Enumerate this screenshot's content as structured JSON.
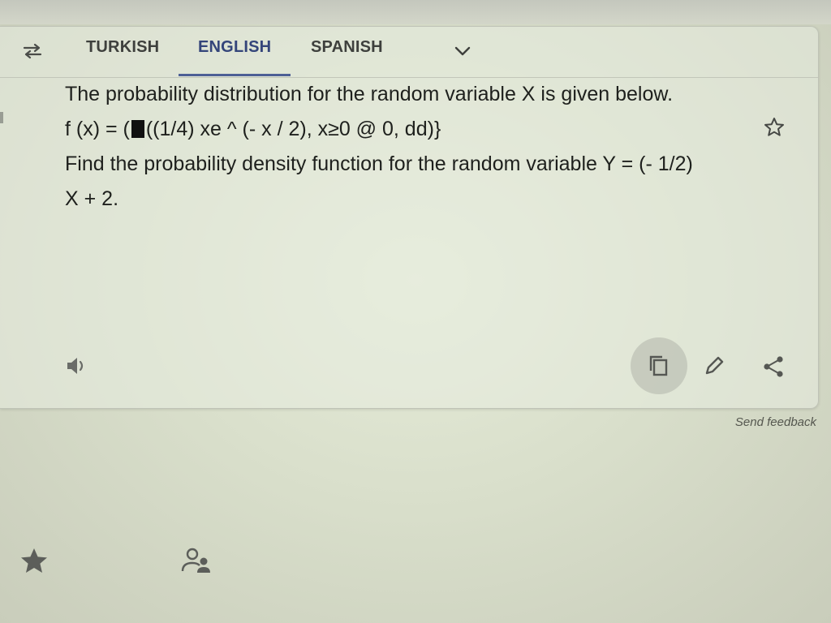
{
  "tabs": [
    {
      "label": "TURKISH",
      "active": false
    },
    {
      "label": "ENGLISH",
      "active": true
    },
    {
      "label": "SPANISH",
      "active": false
    }
  ],
  "translation": {
    "line1": "The probability distribution for the random variable X is given below.",
    "line2_prefix": "f (x) = (",
    "line2_suffix": "((1/4) xe ^ (- x / 2), x≥0 @ 0, dd)}",
    "line3": "Find the probability density function for the random variable Y = (- 1/2)",
    "line4": "X + 2."
  },
  "feedback_label": "Send feedback",
  "icons": {
    "swap": "swap-languages-icon",
    "more_languages": "chevron-down-icon",
    "save": "star-outline-icon",
    "listen": "speaker-icon",
    "copy": "copy-icon",
    "edit": "pencil-icon",
    "share": "share-icon",
    "saved": "star-filled-icon",
    "contribute": "people-icon"
  },
  "colors": {
    "active_tab": "#34457a",
    "tab_underline": "#4d5f95",
    "icon_gray": "#5f6260"
  }
}
